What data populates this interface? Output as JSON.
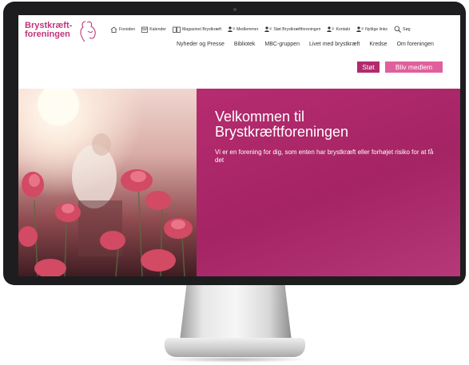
{
  "logo": {
    "line1": "Brystkræft-",
    "line2": "foreningen",
    "figure_icon": "woman-silhouette-icon"
  },
  "topnav": [
    {
      "label": "Forsiden",
      "icon": "house-icon"
    },
    {
      "label": "Kalender",
      "icon": "calendar-icon"
    },
    {
      "label": "Magasinet Brystkræft",
      "icon": "book-icon"
    },
    {
      "label": "Medlemmer",
      "icon": "people-icon"
    },
    {
      "label": "Støt Brystkræftforeningen",
      "icon": "people-icon"
    },
    {
      "label": "Kontakt",
      "icon": "people-icon"
    },
    {
      "label": "Nyttige links",
      "icon": "people-icon"
    },
    {
      "label": "Søg",
      "icon": "search-icon"
    }
  ],
  "mainnav": [
    "Nyheder og Presse",
    "Bibliotek",
    "MBC-gruppen",
    "Livet med brystkræft",
    "Kredse",
    "Om foreningen"
  ],
  "buttons": {
    "support": "Støt",
    "become_member": "Bliv medlem"
  },
  "hero": {
    "title": "Velkommen til Brystkræftforeningen",
    "subtitle": "Vi er en forening for dig, som enten har brystkræft eller forhøjet risiko for at få det"
  },
  "colors": {
    "brand_pink": "#c0357a",
    "button_support": "#b22a6e",
    "button_member": "#e0609d",
    "hero_panel": "#a8256a"
  }
}
